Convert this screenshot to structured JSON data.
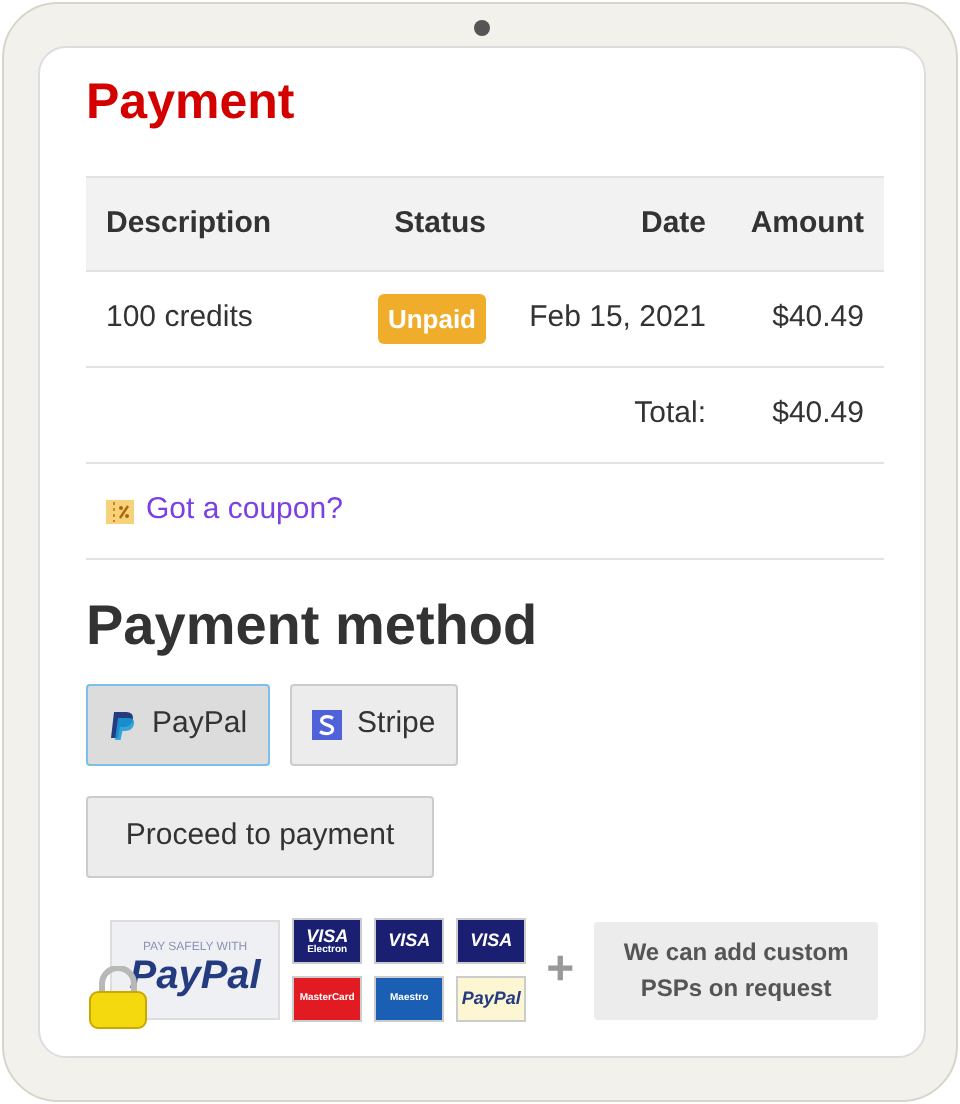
{
  "title": "Payment",
  "table": {
    "columns": [
      "Description",
      "Status",
      "Date",
      "Amount"
    ],
    "rows": [
      {
        "description": "100 credits",
        "status": "Unpaid",
        "date": "Feb 15, 2021",
        "amount": "$40.49"
      }
    ],
    "total_label": "Total:",
    "total": "$40.49"
  },
  "coupon_link": "Got a coupon?",
  "payment_method": {
    "heading": "Payment method",
    "methods": [
      {
        "label": "PayPal",
        "kind": "paypal",
        "selected": true
      },
      {
        "label": "Stripe",
        "kind": "stripe",
        "selected": false
      }
    ]
  },
  "proceed_button": "Proceed to payment",
  "badge": {
    "caption": "PAY SAFELY WITH",
    "brand": "PayPal"
  },
  "cards": [
    {
      "kind": "visa",
      "text": "VISA",
      "subtext": "Electron"
    },
    {
      "kind": "visa",
      "text": "VISA"
    },
    {
      "kind": "visa",
      "text": "VISA"
    },
    {
      "kind": "mastercard",
      "text": "MasterCard"
    },
    {
      "kind": "maestro",
      "text": "Maestro"
    },
    {
      "kind": "paypal",
      "text": "PayPal"
    }
  ],
  "plus": "+",
  "custom_note": "We can add custom PSPs on request"
}
